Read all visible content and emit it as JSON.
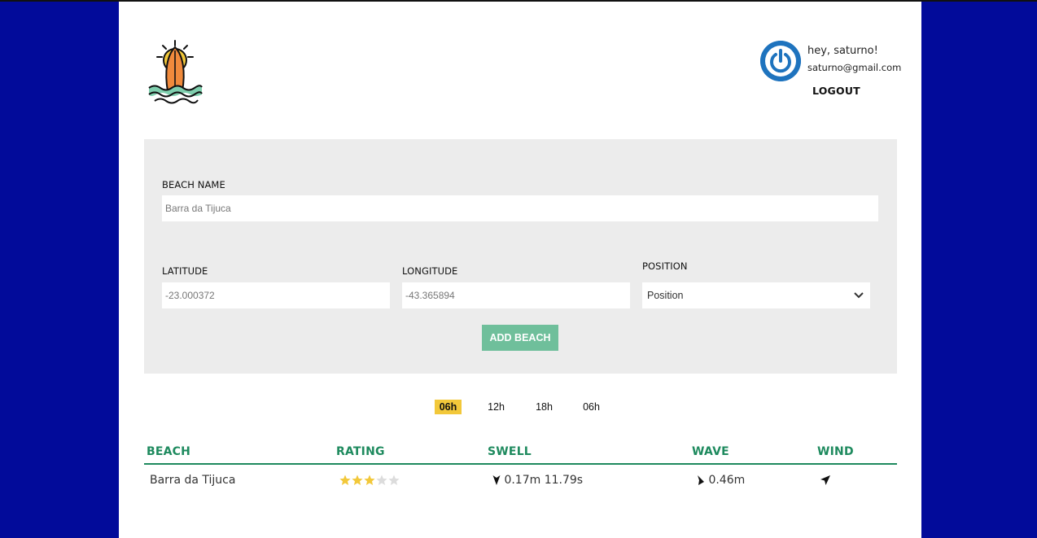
{
  "user": {
    "greeting": "hey, saturno!",
    "email": "saturno@gmail.com",
    "logout_label": "LOGOUT"
  },
  "form": {
    "beach_name_label": "BEACH NAME",
    "beach_name_placeholder": "Barra da Tijuca",
    "latitude_label": "LATITUDE",
    "latitude_placeholder": "-23.000372",
    "longitude_label": "LONGITUDE",
    "longitude_placeholder": "-43.365894",
    "position_label": "POSITION",
    "position_selected": "Position",
    "add_button_label": "ADD BEACH"
  },
  "tabs": [
    {
      "label": "06h",
      "active": true
    },
    {
      "label": "12h",
      "active": false
    },
    {
      "label": "18h",
      "active": false
    },
    {
      "label": "06h",
      "active": false
    }
  ],
  "table": {
    "headers": [
      "BEACH",
      "RATING",
      "SWELL",
      "WAVE",
      "WIND"
    ],
    "rows": [
      {
        "beach": "Barra da Tijuca",
        "rating": 3,
        "rating_max": 5,
        "swell": "0.17m 11.79s",
        "wave": "0.46m"
      }
    ]
  },
  "colors": {
    "background": "#020b9a",
    "accent_green": "#1e8a5e",
    "button_green": "#6fbf9b",
    "star_filled": "#f2c83a",
    "star_empty": "#dcdcdc",
    "tab_active": "#f2c83a"
  },
  "icons": [
    "surfboard-sun-logo-icon",
    "power-avatar-icon",
    "chevron-down-icon",
    "star-icon",
    "direction-arrow-icon"
  ]
}
